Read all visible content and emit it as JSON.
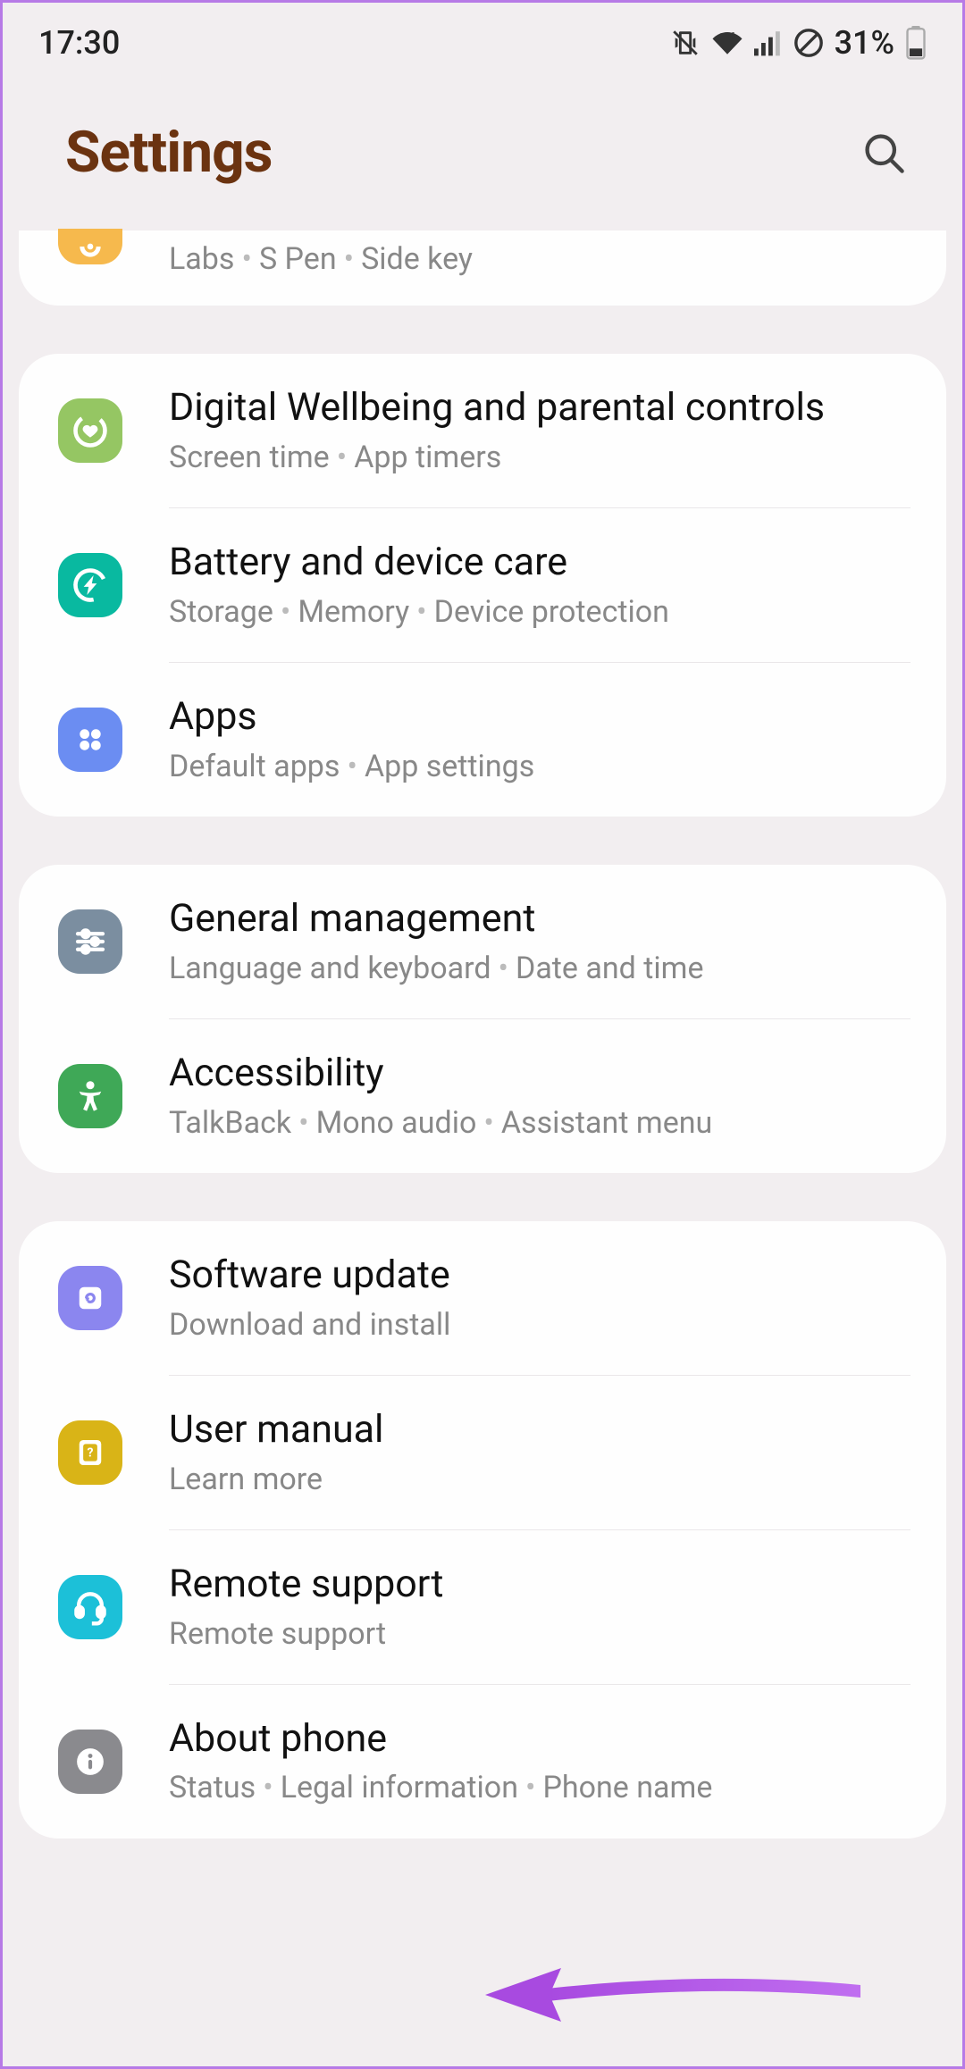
{
  "status": {
    "time": "17:30",
    "battery_pct": "31%"
  },
  "header": {
    "title": "Settings"
  },
  "groups": [
    {
      "partial": true,
      "rows": [
        {
          "id": "advanced",
          "sub": [
            "Labs",
            "S Pen",
            "Side key"
          ]
        }
      ]
    },
    {
      "rows": [
        {
          "id": "wellbeing",
          "title": "Digital Wellbeing and parental controls",
          "sub": [
            "Screen time",
            "App timers"
          ]
        },
        {
          "id": "battery",
          "title": "Battery and device care",
          "sub": [
            "Storage",
            "Memory",
            "Device protection"
          ]
        },
        {
          "id": "apps",
          "title": "Apps",
          "sub": [
            "Default apps",
            "App settings"
          ]
        }
      ]
    },
    {
      "rows": [
        {
          "id": "general",
          "title": "General management",
          "sub": [
            "Language and keyboard",
            "Date and time"
          ]
        },
        {
          "id": "accessibility",
          "title": "Accessibility",
          "sub": [
            "TalkBack",
            "Mono audio",
            "Assistant menu"
          ]
        }
      ]
    },
    {
      "rows": [
        {
          "id": "software",
          "title": "Software update",
          "sub": [
            "Download and install"
          ]
        },
        {
          "id": "manual",
          "title": "User manual",
          "sub": [
            "Learn more"
          ]
        },
        {
          "id": "remote",
          "title": "Remote support",
          "sub": [
            "Remote support"
          ]
        },
        {
          "id": "about",
          "title": "About phone",
          "sub": [
            "Status",
            "Legal information",
            "Phone name"
          ]
        }
      ]
    }
  ]
}
